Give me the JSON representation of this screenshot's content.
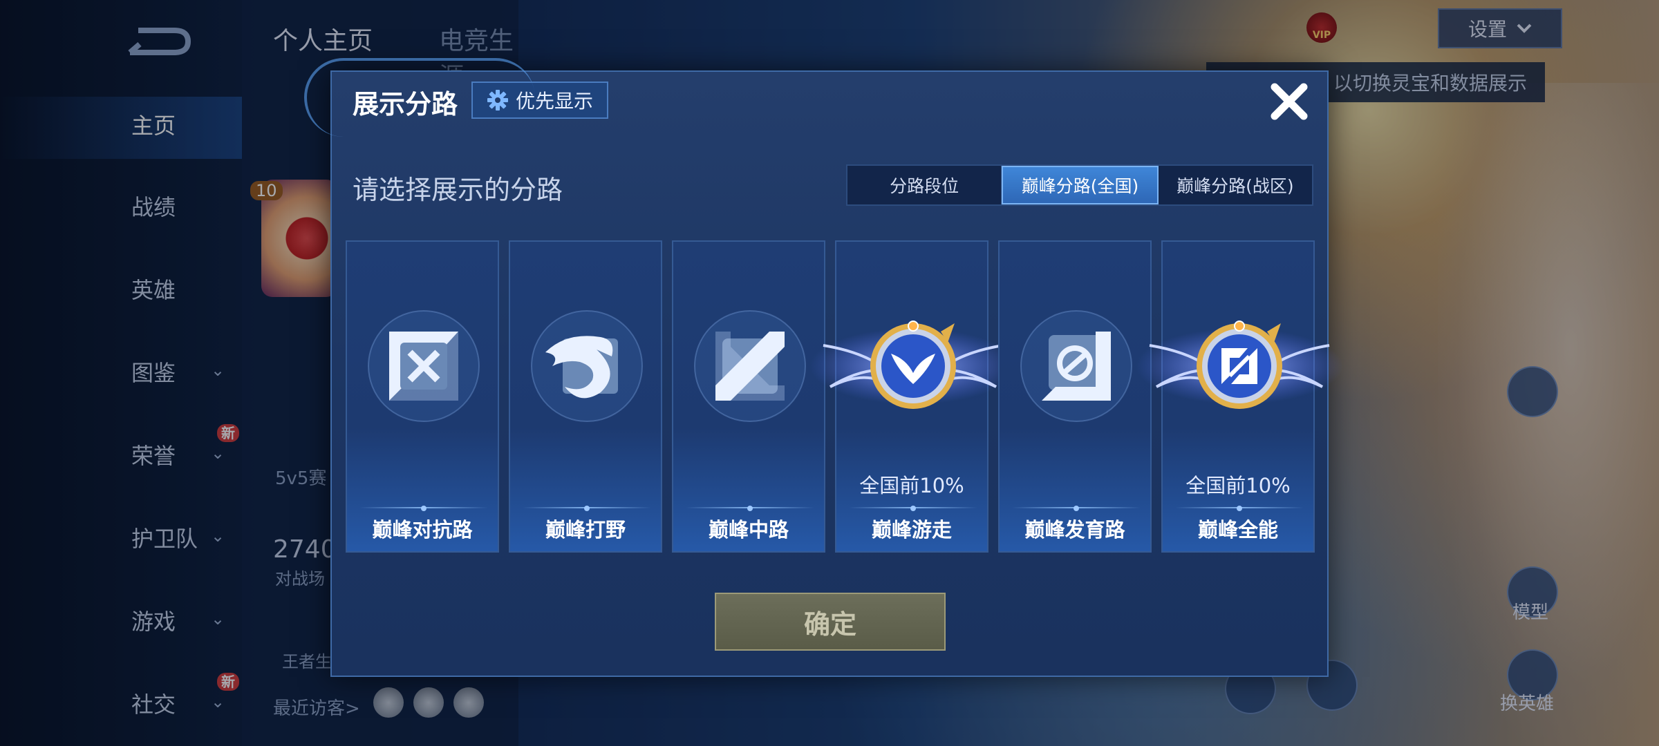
{
  "background": {
    "top_tabs": [
      "个人主页",
      "电竞生涯"
    ],
    "nav": [
      {
        "label": "主页",
        "active": true,
        "chevron": false,
        "badge": ""
      },
      {
        "label": "战绩",
        "active": false,
        "chevron": false,
        "badge": ""
      },
      {
        "label": "英雄",
        "active": false,
        "chevron": false,
        "badge": ""
      },
      {
        "label": "图鉴",
        "active": false,
        "chevron": true,
        "badge": ""
      },
      {
        "label": "荣誉",
        "active": false,
        "chevron": true,
        "badge": "新"
      },
      {
        "label": "护卫队",
        "active": false,
        "chevron": true,
        "badge": ""
      },
      {
        "label": "游戏",
        "active": false,
        "chevron": true,
        "badge": ""
      },
      {
        "label": "社交",
        "active": false,
        "chevron": true,
        "badge": "新"
      }
    ],
    "profile": {
      "level": "10",
      "mode_label": "5v5赛",
      "battles_value": "2740",
      "battles_label": "对战场",
      "bottom_label": "王者生",
      "recent_visitors": "最近访客>"
    },
    "settings_label": "设置",
    "hint_text": "以切换灵宝和数据展示",
    "vip_text": "VIP",
    "right_labels": [
      "模型",
      "换英雄"
    ]
  },
  "modal": {
    "title": "展示分路",
    "priority_button": "优先显示",
    "subtitle": "请选择展示的分路",
    "tabs": [
      {
        "label": "分路段位",
        "active": false
      },
      {
        "label": "巅峰分路(全国)",
        "active": true
      },
      {
        "label": "巅峰分路(战区)",
        "active": false
      }
    ],
    "cards": [
      {
        "name": "巅峰对抗路",
        "rank": "",
        "emblem": "clash-lane-icon",
        "highlighted": false
      },
      {
        "name": "巅峰打野",
        "rank": "",
        "emblem": "jungle-dragon-icon",
        "highlighted": false
      },
      {
        "name": "巅峰中路",
        "rank": "",
        "emblem": "mid-lane-icon",
        "highlighted": false
      },
      {
        "name": "巅峰游走",
        "rank": "全国前10%",
        "emblem": "roam-wings-icon",
        "highlighted": true
      },
      {
        "name": "巅峰发育路",
        "rank": "",
        "emblem": "farm-lane-icon",
        "highlighted": false
      },
      {
        "name": "巅峰全能",
        "rank": "全国前10%",
        "emblem": "allround-icon",
        "highlighted": true
      }
    ],
    "confirm_button": "确定"
  },
  "colors": {
    "accent": "#3f86d8",
    "modal_bg": "#1c3562",
    "confirm_disabled": "#6c6e5a",
    "emblem_gold": "#e2b04a",
    "emblem_blue": "#2b56c8"
  }
}
